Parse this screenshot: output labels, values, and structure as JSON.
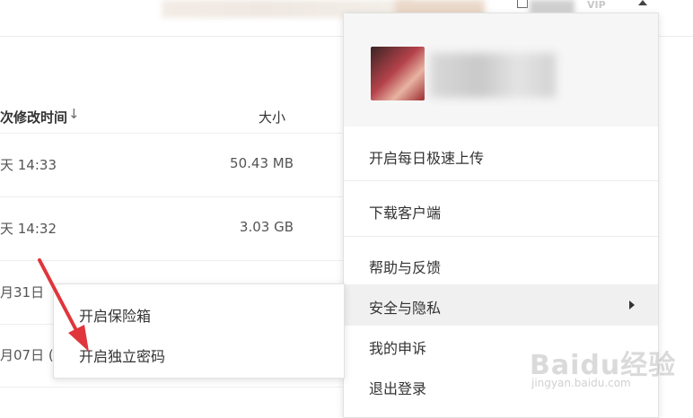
{
  "header": {
    "vip_label": "VIP"
  },
  "file_table": {
    "columns": {
      "modified_time": "次修改时间",
      "size": "大小"
    },
    "rows": [
      {
        "time": "天 14:33",
        "size": "50.43 MB"
      },
      {
        "time": "天 14:32",
        "size": "3.03 GB"
      },
      {
        "time": "月31日",
        "size": ""
      },
      {
        "time": "月07日 (",
        "size": ""
      }
    ]
  },
  "user_menu": {
    "items": [
      {
        "label": "开启每日极速上传"
      },
      {
        "label": "下载客户端"
      },
      {
        "label": "帮助与反馈"
      },
      {
        "label": "安全与隐私"
      },
      {
        "label": "我的申诉"
      },
      {
        "label": "退出登录"
      }
    ]
  },
  "security_submenu": {
    "items": [
      {
        "label": "开启保险箱"
      },
      {
        "label": "开启独立密码"
      }
    ]
  },
  "watermark": {
    "main": "Baidu经验",
    "sub": "jingyan.baidu.com"
  },
  "colors": {
    "annotation_arrow": "#e0353b",
    "menu_active_bg": "#f0f0f0"
  }
}
